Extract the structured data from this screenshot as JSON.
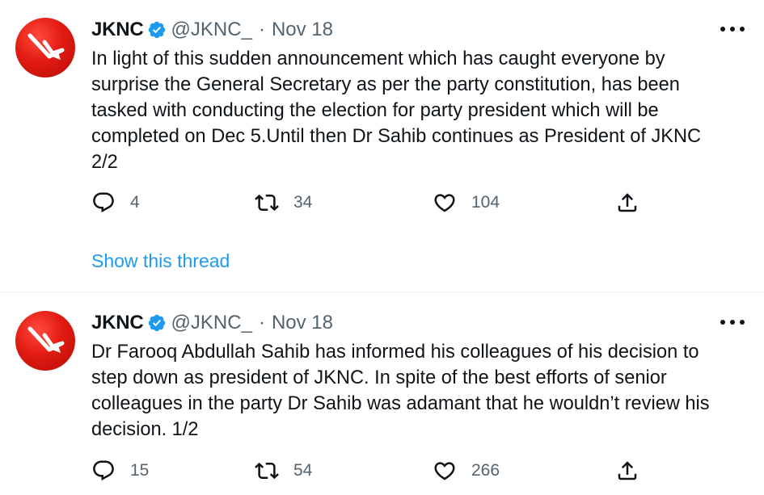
{
  "tweets": [
    {
      "name": "JKNC",
      "handle": "@JKNC_",
      "separator": "·",
      "date": "Nov 18",
      "text": "In light of this sudden announcement which has caught everyone by\nsurprise the General Secretary as per the party constitution, has been\ntasked with conducting the election for party president which will be\ncompleted on Dec 5.Until then Dr Sahib continues as President of JKNC\n2/2",
      "replies": "4",
      "retweets": "34",
      "likes": "104",
      "thread_link": "Show this thread"
    },
    {
      "name": "JKNC",
      "handle": "@JKNC_",
      "separator": "·",
      "date": "Nov 18",
      "text": "Dr Farooq Abdullah Sahib has informed his colleagues of his decision to\nstep down as president of JKNC. In spite of the best efforts of senior\ncolleagues in the party Dr Sahib was adamant that he wouldn’t review his\ndecision. 1/2",
      "replies": "15",
      "retweets": "54",
      "likes": "266"
    }
  ],
  "icons": {
    "avatar": "plough-logo",
    "verified": "verified-badge-icon",
    "more": "more-icon",
    "reply": "reply-icon",
    "retweet": "retweet-icon",
    "like": "like-icon",
    "share": "share-icon"
  },
  "colors": {
    "text": "#0f1419",
    "secondary": "#536471",
    "link": "#1d9bf0",
    "verified": "#1d9bf0",
    "avatar": "#e21b12"
  }
}
